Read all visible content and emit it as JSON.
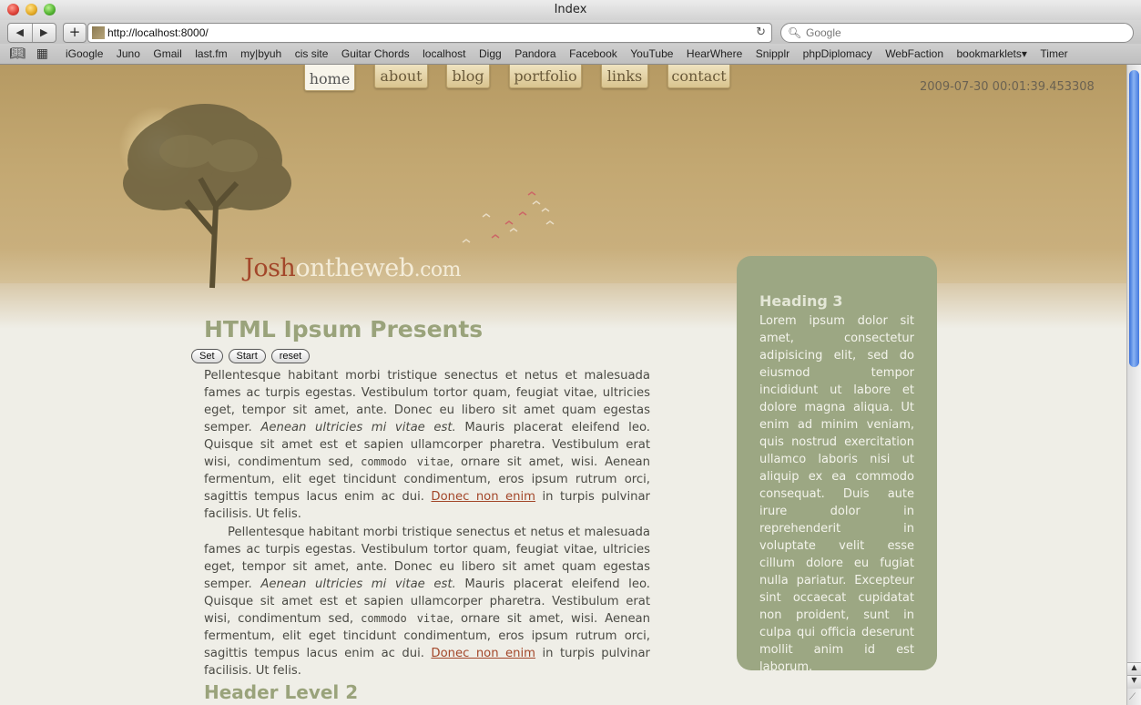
{
  "window": {
    "title": "Index"
  },
  "toolbar": {
    "back": "◀",
    "forward": "▶",
    "add": "+",
    "url": "http://localhost:8000/",
    "reload": "↻",
    "search_placeholder": "Google"
  },
  "bookmarks": [
    "iGoogle",
    "Juno",
    "Gmail",
    "last.fm",
    "my|byuh",
    "cis site",
    "Guitar Chords",
    "localhost",
    "Digg",
    "Pandora",
    "Facebook",
    "YouTube",
    "HearWhere",
    "Snipplr",
    "phpDiplomacy",
    "WebFaction",
    "bookmarklets▾",
    "Timer"
  ],
  "nav": [
    {
      "label": "home",
      "active": true
    },
    {
      "label": "about"
    },
    {
      "label": "blog"
    },
    {
      "label": "portfolio"
    },
    {
      "label": "links"
    },
    {
      "label": "contact"
    }
  ],
  "timestamp": "2009-07-30 00:01:39.453308",
  "logo": {
    "first": "Josh",
    "rest": "ontheweb",
    "tld": ".com"
  },
  "main": {
    "title": "HTML Ipsum Presents",
    "buttons": [
      "Set",
      "Start",
      "reset"
    ],
    "para_a": "Pellentesque habitant morbi tristique senectus et netus et malesuada fames ac turpis egestas. Vestibulum tortor quam, feugiat vitae, ultricies eget, tempor sit amet, ante. Donec eu libero sit amet quam egestas semper.",
    "para_em": "Aenean ultricies mi vitae est.",
    "para_b": "Mauris placerat eleifend leo. Quisque sit amet est et sapien ullamcorper pharetra. Vestibulum erat wisi, condimentum sed,",
    "para_code": "commodo vitae",
    "para_c": ", ornare sit amet, wisi. Aenean fermentum, elit eget tincidunt condimentum, eros ipsum rutrum orci, sagittis tempus lacus enim ac dui.",
    "para_link": "Donec non enim",
    "para_d": "in turpis pulvinar facilisis. Ut felis.",
    "header2": "Header Level 2"
  },
  "sidebar": {
    "heading": "Heading 3",
    "text": "Lorem ipsum dolor sit amet, consectetur adipisicing elit, sed do eiusmod tempor incididunt ut labore et dolore magna aliqua. Ut enim ad minim veniam, quis nostrud exercitation ullamco laboris nisi ut aliquip ex ea commodo consequat. Duis aute irure dolor in reprehenderit in voluptate velit esse cillum dolore eu fugiat nulla pariatur. Excepteur sint occaecat cupidatat non proident, sunt in culpa qui officia deserunt mollit anim id est laborum."
  }
}
